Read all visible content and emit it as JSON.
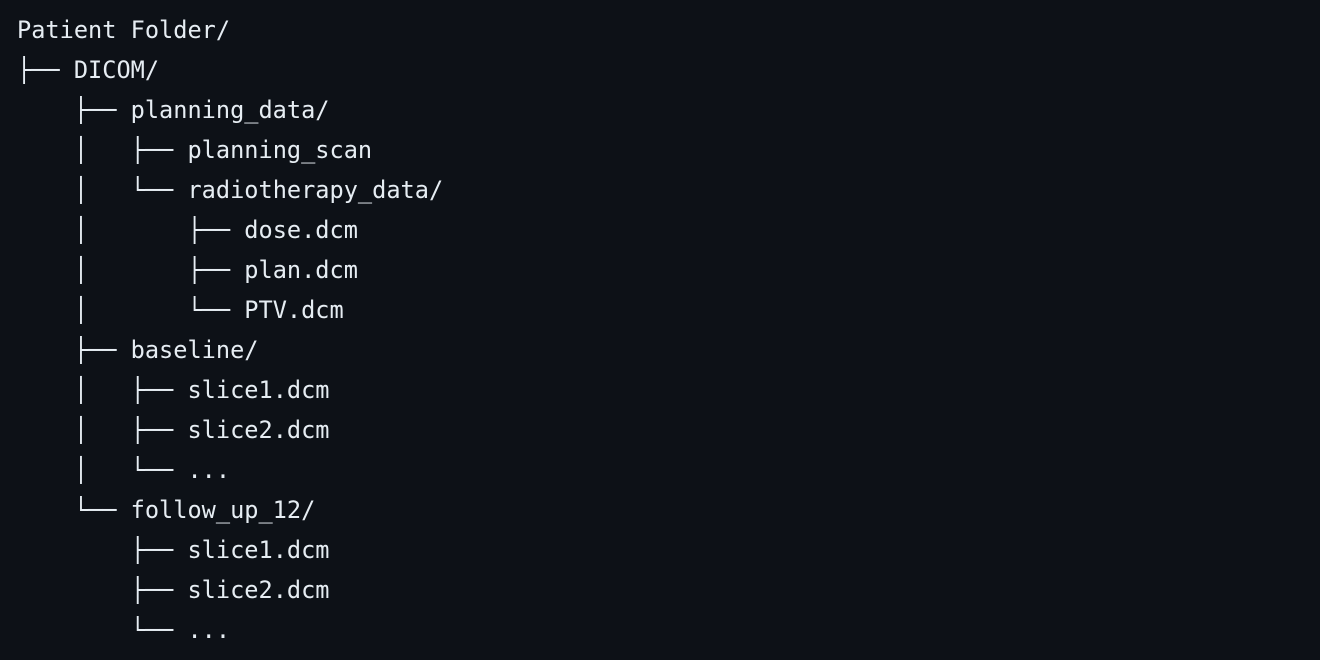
{
  "tree": {
    "lines": [
      {
        "prefix": "",
        "name": "Patient Folder/"
      },
      {
        "prefix": "├── ",
        "name": "DICOM/"
      },
      {
        "prefix": "    ├── ",
        "name": "planning_data/"
      },
      {
        "prefix": "    │   ├── ",
        "name": "planning_scan"
      },
      {
        "prefix": "    │   └── ",
        "name": "radiotherapy_data/"
      },
      {
        "prefix": "    │       ├── ",
        "name": "dose.dcm"
      },
      {
        "prefix": "    │       ├── ",
        "name": "plan.dcm"
      },
      {
        "prefix": "    │       └── ",
        "name": "PTV.dcm"
      },
      {
        "prefix": "    ├── ",
        "name": "baseline/"
      },
      {
        "prefix": "    │   ├── ",
        "name": "slice1.dcm"
      },
      {
        "prefix": "    │   ├── ",
        "name": "slice2.dcm"
      },
      {
        "prefix": "    │   └── ",
        "name": "..."
      },
      {
        "prefix": "    └── ",
        "name": "follow_up_12/"
      },
      {
        "prefix": "        ├── ",
        "name": "slice1.dcm"
      },
      {
        "prefix": "        ├── ",
        "name": "slice2.dcm"
      },
      {
        "prefix": "        └── ",
        "name": "..."
      }
    ]
  },
  "colors": {
    "background": "#0d1117",
    "text": "#e6edf3"
  }
}
